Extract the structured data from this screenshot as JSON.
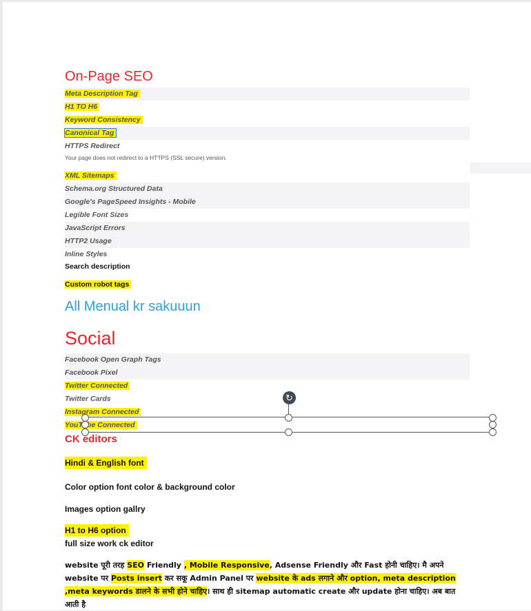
{
  "onpage": {
    "heading": "On-Page SEO",
    "items": [
      "Meta Description Tag",
      "H1 TO H6",
      "Keyword Consistency",
      "Canonical Tag",
      "HTTPS Redirect",
      "XML Sitemaps",
      "Schema.org Structured Data",
      "Google's PageSpeed Insights - Mobile",
      "Legible Font Sizes",
      "JavaScript Errors",
      "HTTP2 Usage",
      "Inline Styles",
      "Search description",
      "Custom robot tags"
    ],
    "https_note": "Your page does not redirect to a HTTPS (SSL secure) version."
  },
  "menual": "All Menual kr sakuuun",
  "social": {
    "heading": "Social",
    "items": [
      "Facebook Open Graph Tags",
      "Facebook Pixel",
      "Twitter Connected",
      "Twitter Cards",
      "Instagram Connected",
      "YouTube Connected"
    ]
  },
  "ck": {
    "heading": "CK editors",
    "lines": [
      "Hindi & English  font",
      "Color option font color & background color",
      "Images option gallry",
      "H1 to H6 option",
      "full size work ck editor"
    ]
  },
  "paragraph": {
    "p1": "website पूरी तरह ",
    "p2": "SEO",
    "p3": " Friendly ",
    "p4": ", Mobile Responsive",
    "p5": ", Adsense Friendly और Fast होनी चाहिए। मै अपने website पर ",
    "p6": "Posts insert",
    "p7": " कर सकू Admin Panel पर ",
    "p8": "website के ads लगाने और option, meta description ,meta keywords डालने के सभी होने चाहिए",
    "p9": "। साथ ही sitemap automatic create और update होना चाहिए। अब बात आती है"
  },
  "colors": {
    "highlight": "#fff200",
    "heading_red": "#e8262a",
    "heading_blue": "#29a3d9"
  }
}
